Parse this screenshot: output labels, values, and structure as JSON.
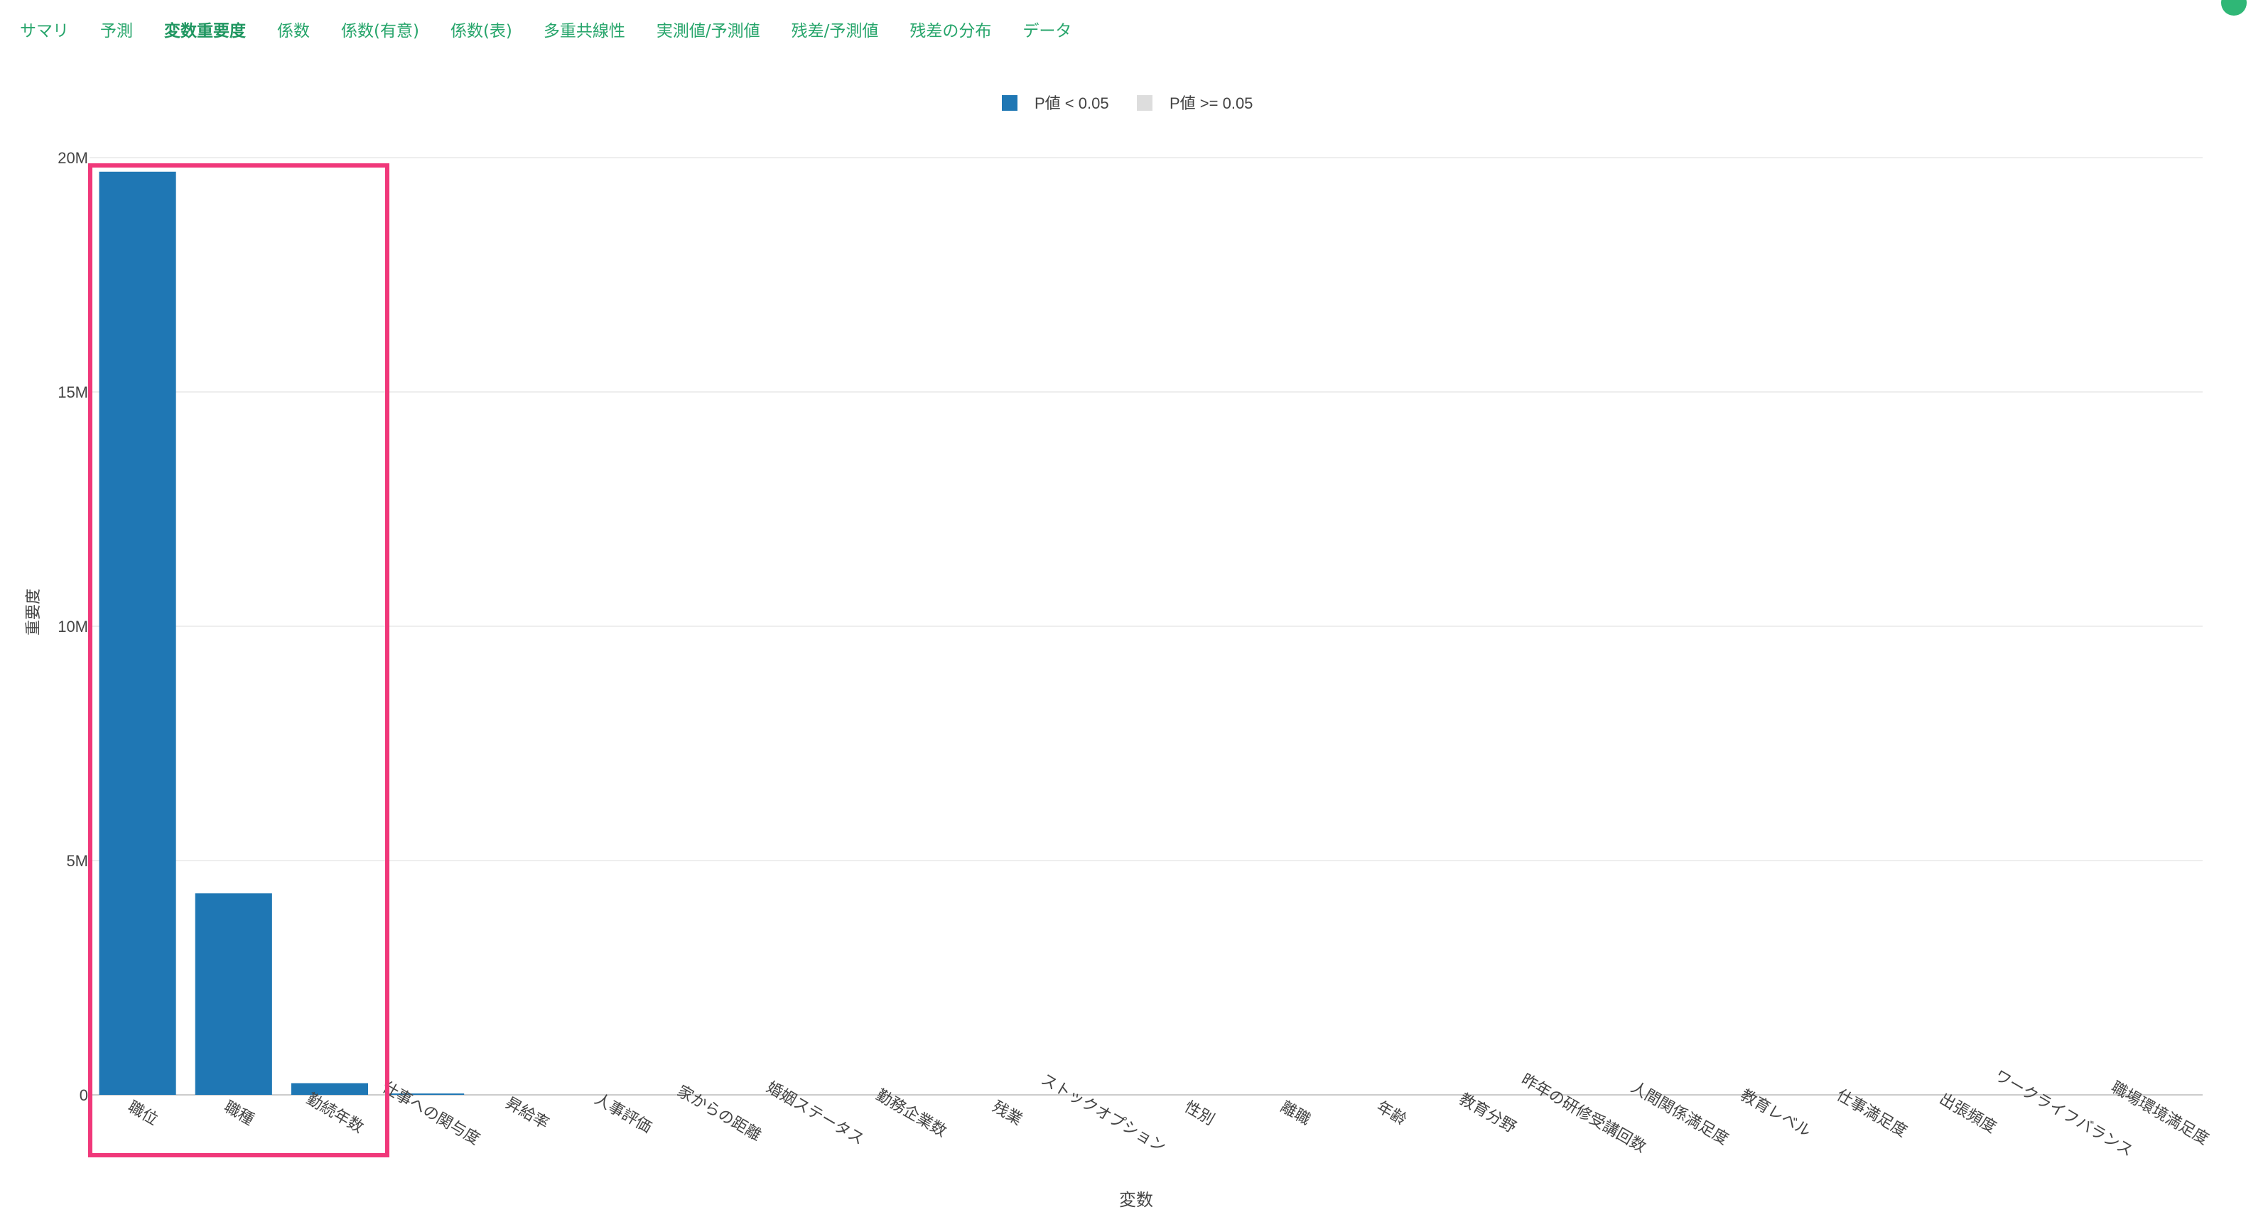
{
  "tabs": [
    {
      "label": "サマリ",
      "active": false
    },
    {
      "label": "予測",
      "active": false
    },
    {
      "label": "変数重要度",
      "active": true
    },
    {
      "label": "係数",
      "active": false
    },
    {
      "label": "係数(有意)",
      "active": false
    },
    {
      "label": "係数(表)",
      "active": false
    },
    {
      "label": "多重共線性",
      "active": false
    },
    {
      "label": "実測値/予測値",
      "active": false
    },
    {
      "label": "残差/予測値",
      "active": false
    },
    {
      "label": "残差の分布",
      "active": false
    },
    {
      "label": "データ",
      "active": false
    }
  ],
  "colors": {
    "tab_text": "#27a56b",
    "significant": "#1f77b4",
    "not_significant": "#dddddd",
    "highlight_box": "#f0387a",
    "grid": "#eeeeee"
  },
  "chart_data": {
    "type": "bar",
    "title": "",
    "xlabel": "変数",
    "ylabel": "重要度",
    "ylim": [
      0,
      20000000
    ],
    "yticks": [
      0,
      5000000,
      10000000,
      15000000,
      20000000
    ],
    "ytick_labels": [
      "0",
      "5M",
      "10M",
      "15M",
      "20M"
    ],
    "grid": true,
    "legend_position": "top-center",
    "legend": [
      {
        "label": "P値 < 0.05",
        "color": "#1f77b4"
      },
      {
        "label": "P値 >= 0.05",
        "color": "#dddddd"
      }
    ],
    "categories": [
      "職位",
      "職種",
      "勤続年数",
      "仕事への関与度",
      "昇給率",
      "人事評価",
      "家からの距離",
      "婚姻ステータス",
      "勤務企業数",
      "残業",
      "ストックオプション",
      "性別",
      "離職",
      "年齢",
      "教育分野",
      "昨年の研修受講回数",
      "人間関係満足度",
      "教育レベル",
      "仕事満足度",
      "出張頻度",
      "ワークライフバランス",
      "職場環境満足度"
    ],
    "values": [
      19700000,
      4300000,
      250000,
      30000,
      0,
      0,
      0,
      0,
      0,
      0,
      0,
      0,
      0,
      0,
      0,
      0,
      0,
      0,
      0,
      0,
      0,
      0
    ],
    "significant": [
      true,
      true,
      true,
      true,
      true,
      true,
      true,
      true,
      true,
      true,
      true,
      true,
      true,
      true,
      true,
      true,
      true,
      true,
      true,
      true,
      true,
      true
    ]
  }
}
